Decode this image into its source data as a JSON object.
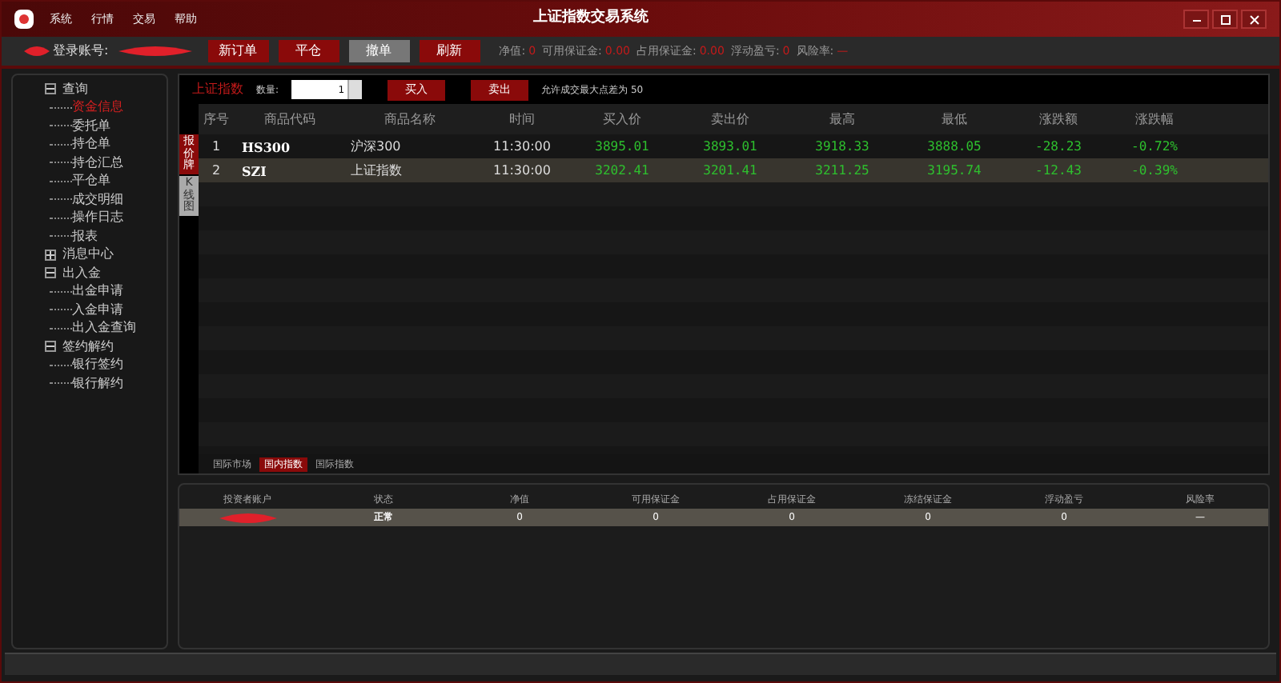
{
  "window": {
    "title": "上证指数交易系统"
  },
  "menu": [
    "系统",
    "行情",
    "交易",
    "帮助"
  ],
  "toolbar": {
    "account_label": "登录账号:",
    "buttons": [
      {
        "label": "新订单",
        "selected": false
      },
      {
        "label": "平仓",
        "selected": false
      },
      {
        "label": "撤单",
        "selected": true
      },
      {
        "label": "刷新",
        "selected": false
      }
    ],
    "stats": [
      {
        "label": "净值:",
        "value": "0"
      },
      {
        "label": "可用保证金:",
        "value": "0.00"
      },
      {
        "label": "占用保证金:",
        "value": "0.00"
      },
      {
        "label": "浮动盈亏:",
        "value": "0"
      },
      {
        "label": "风险率:",
        "value": "—"
      }
    ]
  },
  "sidebar": {
    "tree": [
      {
        "label": "查询",
        "expanded": true,
        "children": [
          {
            "label": "资金信息",
            "selected": true
          },
          {
            "label": "委托单",
            "selected": false
          },
          {
            "label": "持仓单",
            "selected": false
          },
          {
            "label": "持仓汇总",
            "selected": false
          },
          {
            "label": "平仓单",
            "selected": false
          },
          {
            "label": "成交明细",
            "selected": false
          },
          {
            "label": "操作日志",
            "selected": false
          },
          {
            "label": "报表",
            "selected": false
          }
        ]
      },
      {
        "label": "消息中心",
        "expanded": false
      },
      {
        "label": "出入金",
        "expanded": true,
        "children": [
          {
            "label": "出金申请",
            "selected": false
          },
          {
            "label": "入金申请",
            "selected": false
          },
          {
            "label": "出入金查询",
            "selected": false
          }
        ]
      },
      {
        "label": "签约解约",
        "expanded": true,
        "children": [
          {
            "label": "银行签约",
            "selected": false
          },
          {
            "label": "银行解约",
            "selected": false
          }
        ]
      }
    ]
  },
  "order_bar": {
    "symbol": "上证指数",
    "qty_label": "数量:",
    "qty_value": "1",
    "buy": "买入",
    "sell": "卖出",
    "note": "允许成交最大点差为 50"
  },
  "side_tabs": [
    {
      "label": "报价牌",
      "selected": true
    },
    {
      "label": "K线图",
      "selected": false
    }
  ],
  "quotes": {
    "columns": [
      "序号",
      "商品代码",
      "商品名称",
      "时间",
      "买入价",
      "卖出价",
      "最高",
      "最低",
      "涨跌额",
      "涨跌幅"
    ],
    "rows": [
      {
        "selected": false,
        "cells": [
          "1",
          "HS300",
          "沪深300",
          "11:30:00",
          "3895.01",
          "3893.01",
          "3918.33",
          "3888.05",
          "-28.23",
          "-0.72%"
        ]
      },
      {
        "selected": true,
        "cells": [
          "2",
          "SZI",
          "上证指数",
          "11:30:00",
          "3202.41",
          "3201.41",
          "3211.25",
          "3195.74",
          "-12.43",
          "-0.39%"
        ]
      }
    ]
  },
  "market_tabs": [
    {
      "label": "国际市场",
      "selected": false
    },
    {
      "label": "国内指数",
      "selected": true
    },
    {
      "label": "国际指数",
      "selected": false
    }
  ],
  "account_table": {
    "columns": [
      "投资者账户",
      "状态",
      "净值",
      "可用保证金",
      "占用保证金",
      "冻结保证金",
      "浮动盈亏",
      "风险率"
    ],
    "rows": [
      {
        "cells": [
          "",
          "正常",
          "0",
          "0",
          "0",
          "0",
          "0",
          "—"
        ]
      }
    ]
  }
}
